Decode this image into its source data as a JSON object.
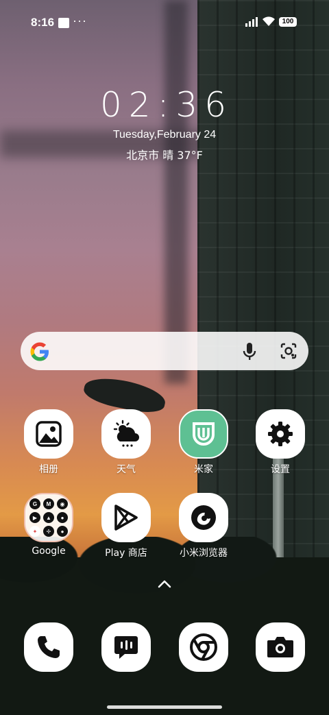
{
  "status_bar": {
    "time": "8:16",
    "dots": "···",
    "battery": "100"
  },
  "clock": {
    "time": "02:36",
    "date": "Tuesday,February 24",
    "weather": "北京市 晴 37°F"
  },
  "search": {
    "icons": [
      "google-g-icon",
      "mic-icon",
      "lens-icon"
    ]
  },
  "apps": {
    "gallery": "相册",
    "weather": "天气",
    "mijia": "米家",
    "settings": "设置",
    "google_folder": "Google",
    "play_store": "Play 商店",
    "mi_browser": "小米浏览器"
  },
  "google_folder_minis": [
    "G",
    "M",
    "",
    "",
    "",
    "",
    "",
    "",
    ""
  ],
  "dock": [
    "phone-icon",
    "messages-icon",
    "chrome-icon",
    "camera-icon"
  ],
  "colors": {
    "mijia_green": "#5ec093",
    "search_bg": "#ffffff"
  }
}
